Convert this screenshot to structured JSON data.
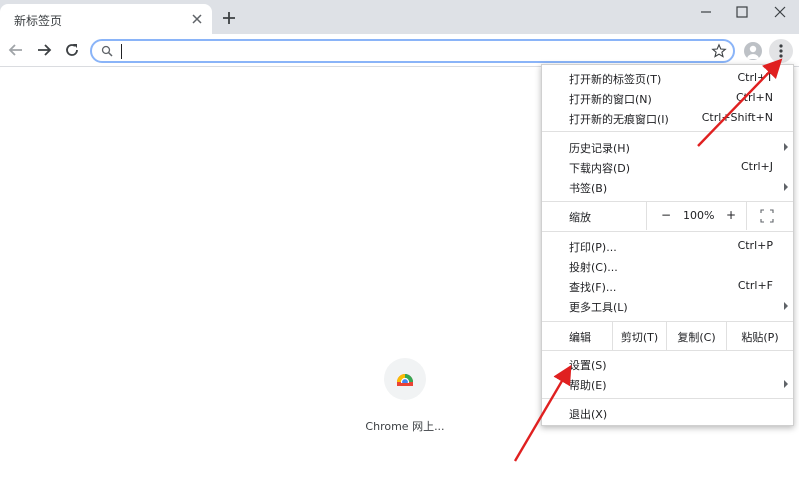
{
  "tab": {
    "title": "新标签页"
  },
  "omnibox": {
    "value": "",
    "placeholder": ""
  },
  "shortcut": {
    "label": "Chrome 网上..."
  },
  "menu": {
    "new_tab": {
      "label": "打开新的标签页(T)",
      "shortcut": "Ctrl+T"
    },
    "new_window": {
      "label": "打开新的窗口(N)",
      "shortcut": "Ctrl+N"
    },
    "new_incognito": {
      "label": "打开新的无痕窗口(I)",
      "shortcut": "Ctrl+Shift+N"
    },
    "history": {
      "label": "历史记录(H)"
    },
    "downloads": {
      "label": "下载内容(D)",
      "shortcut": "Ctrl+J"
    },
    "bookmarks": {
      "label": "书签(B)"
    },
    "zoom": {
      "label": "缩放",
      "minus": "−",
      "value": "100%",
      "plus": "+"
    },
    "print": {
      "label": "打印(P)...",
      "shortcut": "Ctrl+P"
    },
    "cast": {
      "label": "投射(C)..."
    },
    "find": {
      "label": "查找(F)...",
      "shortcut": "Ctrl+F"
    },
    "more_tools": {
      "label": "更多工具(L)"
    },
    "edit": {
      "label": "编辑",
      "cut": "剪切(T)",
      "copy": "复制(C)",
      "paste": "粘贴(P)"
    },
    "settings": {
      "label": "设置(S)"
    },
    "help": {
      "label": "帮助(E)"
    },
    "exit": {
      "label": "退出(X)"
    }
  },
  "colors": {
    "tabstrip": "#dee1e6",
    "omnibox_focus": "#8ab4f8",
    "annotation_arrow": "#e02020"
  }
}
